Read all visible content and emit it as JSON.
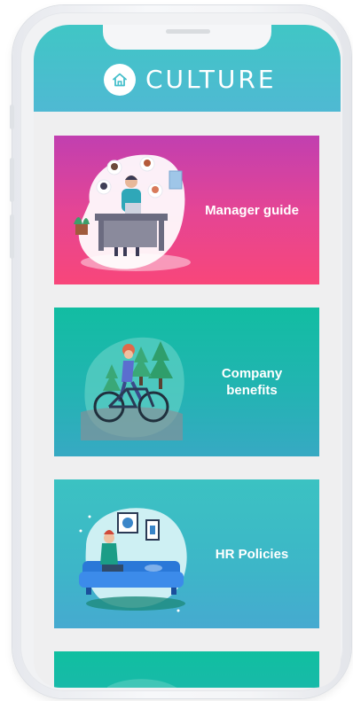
{
  "header": {
    "title": "CULTURE",
    "icon": "home-icon"
  },
  "cards": [
    {
      "label": "Manager guide",
      "illustration": "manager-illustration",
      "colors": [
        "#c13fb0",
        "#f8467a"
      ]
    },
    {
      "label": "Company benefits",
      "illustration": "cyclist-illustration",
      "colors": [
        "#12bda2",
        "#37a9c3"
      ]
    },
    {
      "label": "HR Policies",
      "illustration": "sofa-illustration",
      "colors": [
        "#3bc2c2",
        "#46aad0"
      ]
    },
    {
      "label": "",
      "illustration": "",
      "colors": [
        "#10bfa0",
        "#1cb7ad"
      ]
    }
  ]
}
